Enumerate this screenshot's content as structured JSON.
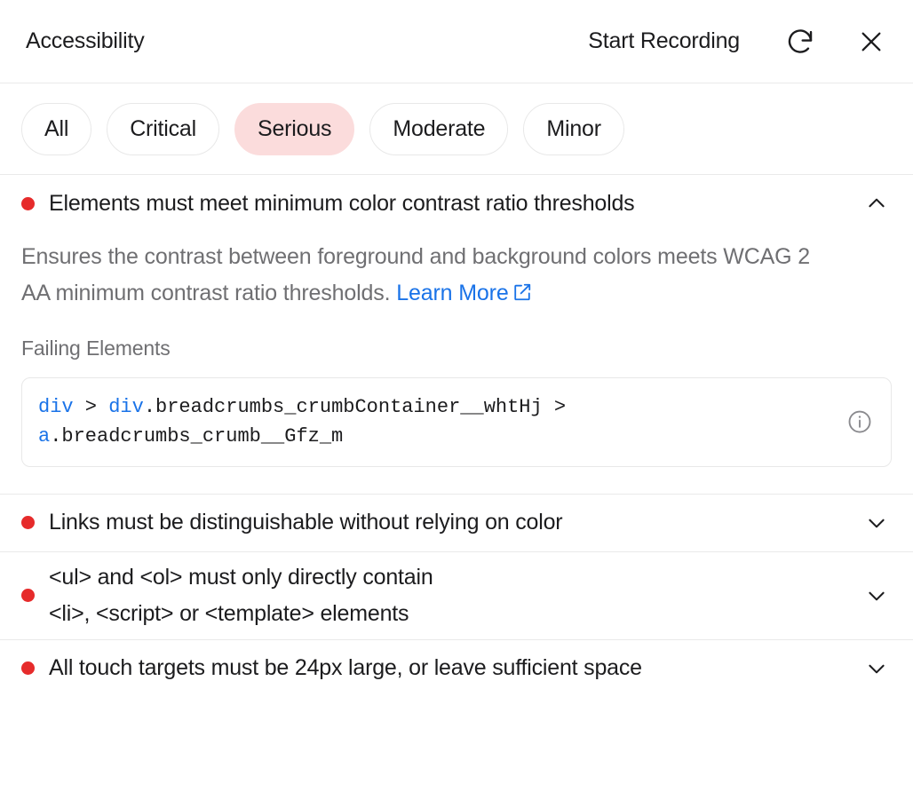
{
  "header": {
    "title": "Accessibility",
    "record_label": "Start Recording",
    "refresh_icon": "refresh-icon",
    "close_icon": "close-icon"
  },
  "filters": [
    {
      "label": "All",
      "active": false
    },
    {
      "label": "Critical",
      "active": false
    },
    {
      "label": "Serious",
      "active": true
    },
    {
      "label": "Moderate",
      "active": false
    },
    {
      "label": "Minor",
      "active": false
    }
  ],
  "violations": [
    {
      "title": "Elements must meet minimum color contrast ratio thresholds",
      "title_line2": "",
      "expanded": true,
      "chevron": "chevron-up-icon",
      "severity_color": "#e62b2b",
      "description": "Ensures the contrast between foreground and background colors meets WCAG 2 AA minimum contrast ratio thresholds.",
      "learn_more_label": "Learn More",
      "failing_label": "Failing Elements",
      "selector": {
        "tag1": "div",
        "comb1": " > ",
        "tag2": "div",
        "class1": ".breadcrumbs_crumbContainer__whtHj",
        "comb2": " > ",
        "tag3": "a",
        "class2": ".breadcrumbs_crumb__Gfz_m"
      },
      "info_icon": "info-icon"
    },
    {
      "title": "Links must be distinguishable without relying on color",
      "title_line2": "",
      "expanded": false,
      "chevron": "chevron-down-icon",
      "severity_color": "#e62b2b"
    },
    {
      "title": "<ul> and <ol> must only directly contain",
      "title_line2": "<li>, <script> or <template> elements",
      "expanded": false,
      "chevron": "chevron-down-icon",
      "severity_color": "#e62b2b"
    },
    {
      "title": "All touch targets must be 24px large, or leave sufficient space",
      "title_line2": "",
      "expanded": false,
      "chevron": "chevron-down-icon",
      "severity_color": "#e62b2b"
    }
  ],
  "colors": {
    "accent_blue": "#1a73e8",
    "severity_red": "#e62b2b",
    "active_pill_bg": "#fbdcdc",
    "divider": "#eaeaea",
    "muted_text": "#6f6f72"
  }
}
